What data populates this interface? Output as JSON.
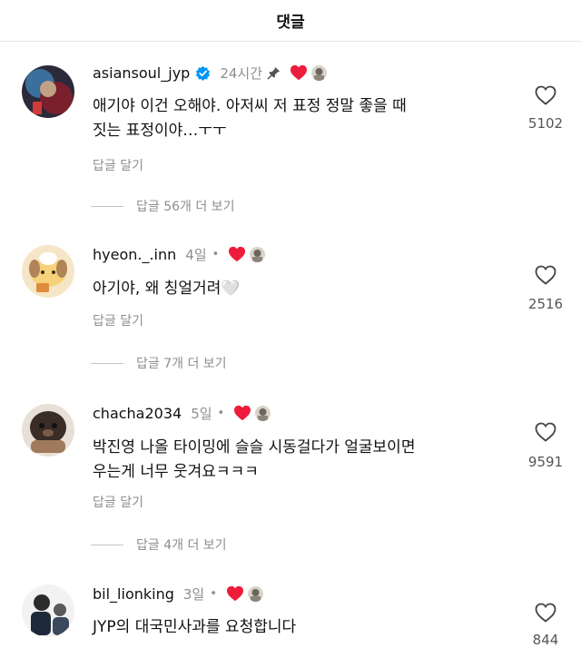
{
  "header": {
    "title": "댓글"
  },
  "comments": [
    {
      "username": "asiansoul_jyp",
      "verified": true,
      "time": "24시간",
      "pinned": true,
      "dot": "",
      "text_lines": [
        "애기야 이건 오해야. 아저씨 저 표정 정말 좋을 때",
        "짓는 표정이야…ㅜㅜ"
      ],
      "reply_label": "답글 달기",
      "likes": "5102",
      "view_replies": "답글 56개 더 보기"
    },
    {
      "username": "hyeon._.inn",
      "verified": false,
      "time": "4일",
      "pinned": false,
      "dot": "•",
      "text_lines": [
        "아기야, 왜 칭얼거려🤍"
      ],
      "reply_label": "답글 달기",
      "likes": "2516",
      "view_replies": "답글 7개 더 보기"
    },
    {
      "username": "chacha2034",
      "verified": false,
      "time": "5일",
      "pinned": false,
      "dot": "•",
      "text_lines": [
        "박진영 나올 타이밍에  슬슬 시동걸다가 얼굴보이면",
        "우는게 너무 웃겨요ㅋㅋㅋ"
      ],
      "reply_label": "답글 달기",
      "likes": "9591",
      "view_replies": "답글 4개 더 보기"
    },
    {
      "username": "bil_lionking",
      "verified": false,
      "time": "3일",
      "pinned": false,
      "dot": "•",
      "text_lines": [
        "JYP의 대국민사과를 요청합니다"
      ],
      "reply_label": "",
      "likes": "844",
      "view_replies": ""
    }
  ],
  "colors": {
    "heart": "#ed1c3a",
    "verified": "#0095f6",
    "muted": "#8e8e8e"
  },
  "icons": {
    "like": "heart-outline-icon",
    "creator_like": "heart-filled-icon",
    "pin": "pin-icon",
    "verified": "verified-badge-icon"
  }
}
